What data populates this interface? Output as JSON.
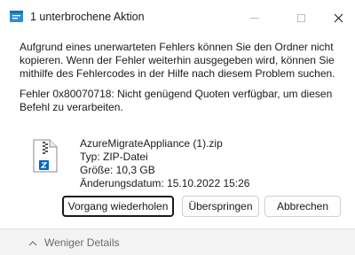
{
  "window": {
    "title": "1 unterbrochene Aktion",
    "controls": [
      "minimize-icon",
      "maximize-icon",
      "close-icon"
    ]
  },
  "message": {
    "line1": "Aufgrund eines unerwarteten Fehlers können Sie den Ordner nicht kopieren. Wenn der Fehler weiterhin ausgegeben wird, können Sie mithilfe des Fehlercodes in der Hilfe nach diesem Problem suchen.",
    "line2": "Fehler 0x80070718: Nicht genügend Quoten verfügbar, um diesen Befehl zu verarbeiten."
  },
  "file": {
    "icon": "zip-folder-icon",
    "name": "AzureMigrateAppliance (1).zip",
    "type": "Typ: ZIP-Datei",
    "size": "Größe: 10,3 GB",
    "modified": "Änderungsdatum: 15.10.2022 15:26"
  },
  "buttons": {
    "retry": "Vorgang wiederholen",
    "skip": "Überspringen",
    "cancel": "Abbrechen"
  },
  "footer": {
    "toggle_icon": "chevron-up-icon",
    "label": "Weniger Details"
  },
  "colors": {
    "accent": "#0067c0",
    "titlebar": "#ffffff",
    "footer": "#f3f3f3"
  }
}
